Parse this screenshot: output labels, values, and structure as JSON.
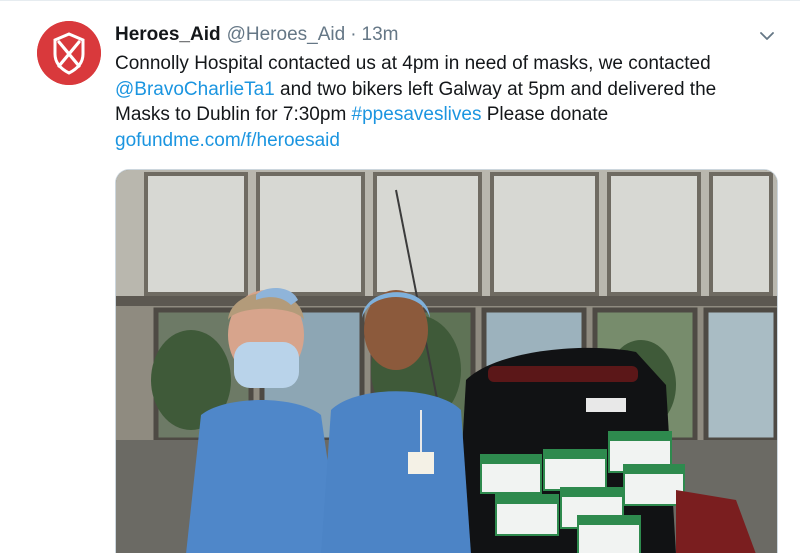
{
  "tweet": {
    "display_name": "Heroes_Aid",
    "handle": "@Heroes_Aid",
    "separator": "·",
    "time": "13m",
    "text": {
      "part1": "Connolly Hospital contacted us at 4pm in need of masks, we contacted ",
      "mention": "@BravoCharlieTa1",
      "part2": " and two bikers left Galway at 5pm and delivered the Masks to Dublin for 7:30pm ",
      "hashtag": "#ppesaveslives",
      "part3": " Please donate ",
      "url": "gofundme.com/f/heroesaid"
    }
  },
  "icons": {
    "avatar": "shield-logo-icon",
    "menu": "chevron-down-icon"
  },
  "colors": {
    "brand_red": "#d9393c",
    "link_blue": "#1b95e0",
    "secondary_text": "#657786"
  }
}
